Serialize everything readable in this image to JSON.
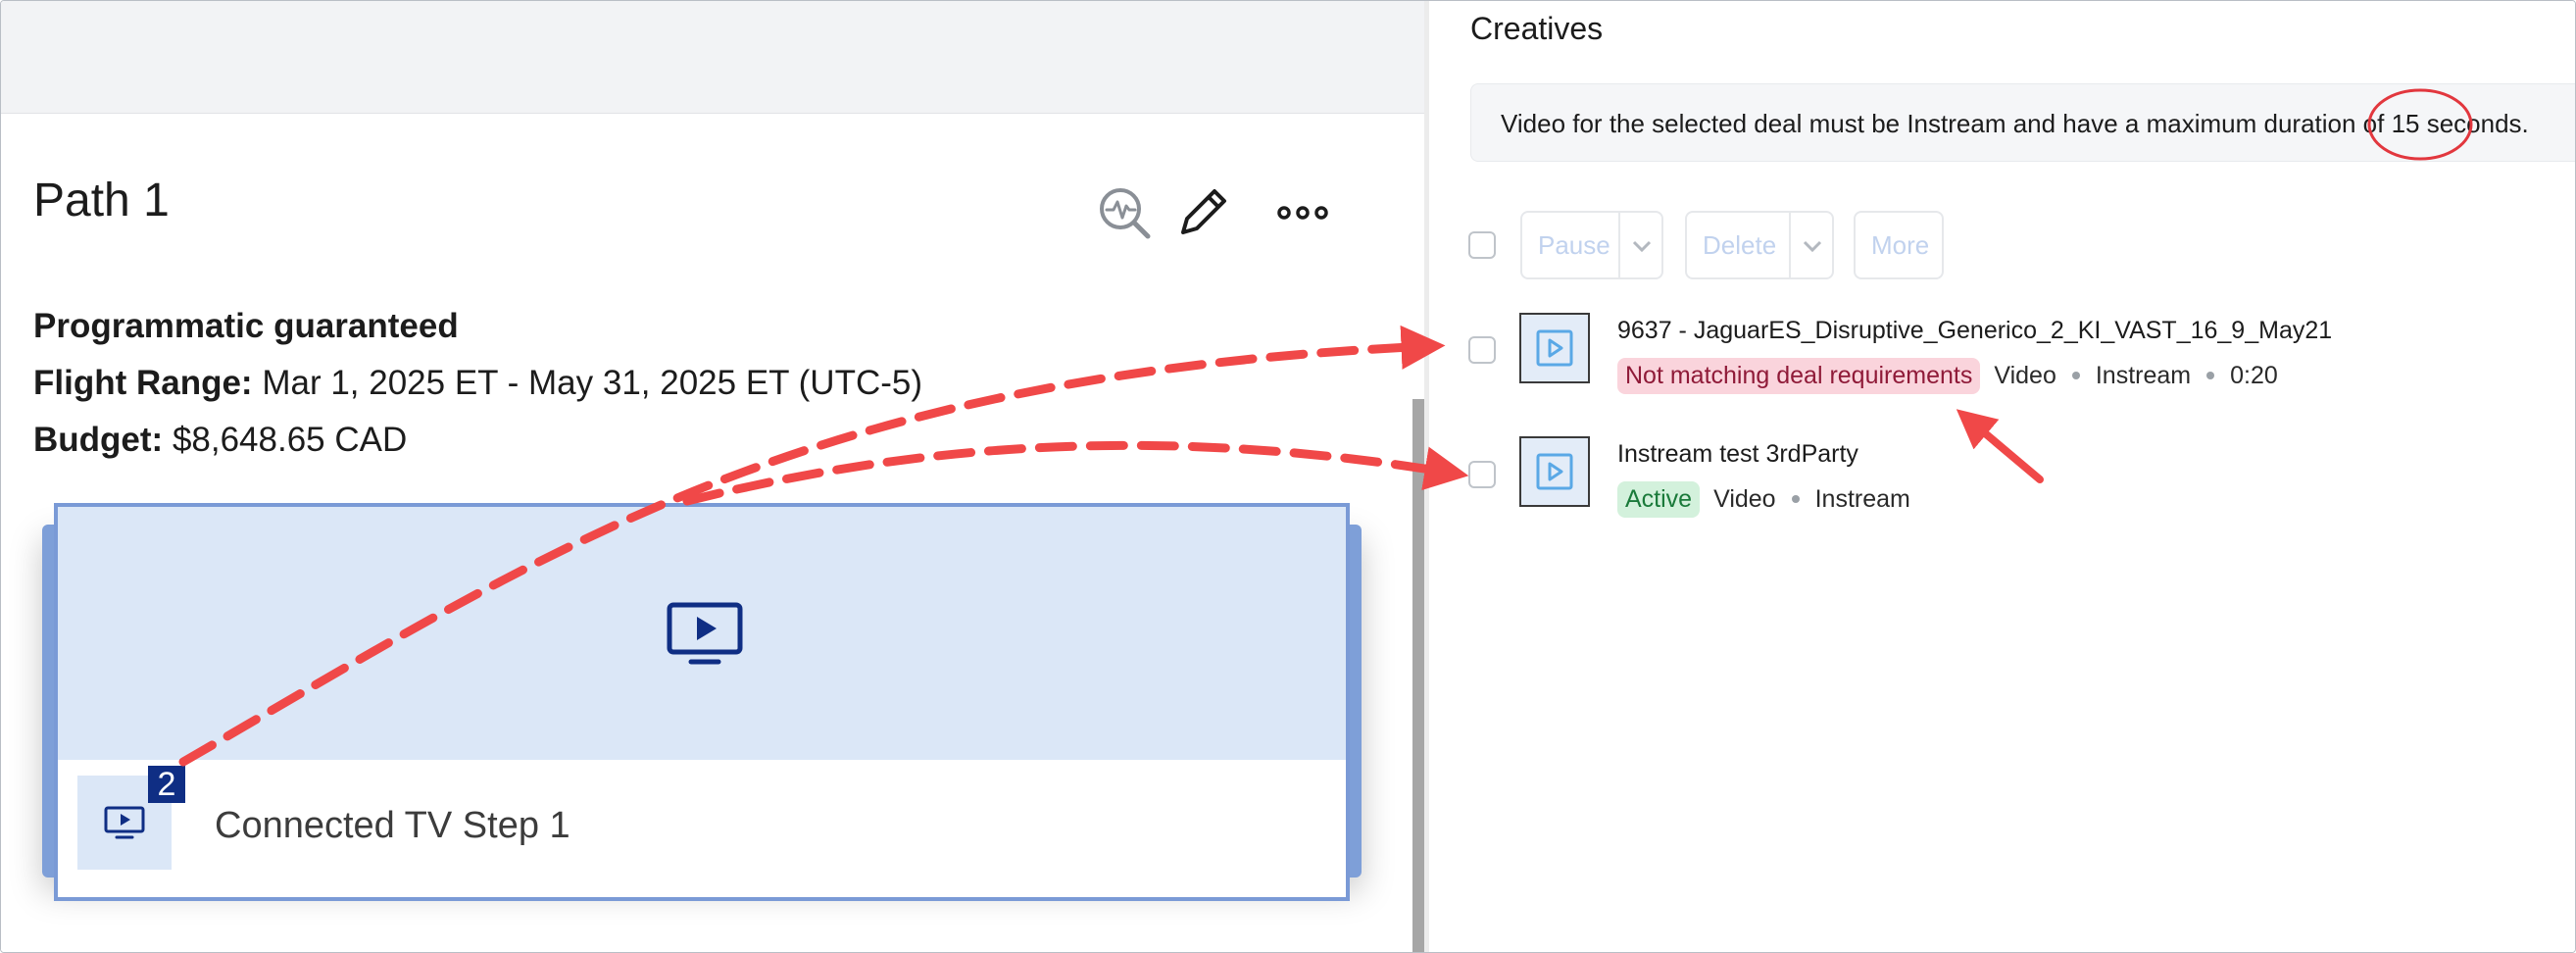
{
  "left": {
    "path_title": "Path 1",
    "deal_type": "Programmatic guaranteed",
    "flight_label": "Flight Range:",
    "flight_value": "Mar 1, 2025 ET - May 31, 2025 ET (UTC-5)",
    "budget_label": "Budget:",
    "budget_value": "$8,648.65 CAD",
    "tools": [
      "monitor-icon",
      "edit-icon",
      "more-icon"
    ],
    "step": {
      "badge_count": "2",
      "label": "Connected TV Step 1",
      "icon": "tv-play-icon"
    }
  },
  "right": {
    "title": "Creatives",
    "notice_text": "Video for the selected deal must be Instream and have a maximum duration of 15 seconds.",
    "toolbar": {
      "pause_label": "Pause",
      "delete_label": "Delete",
      "more_label": "More"
    },
    "creatives": [
      {
        "name": "9637 - JaguarES_Disruptive_Generico_2_KI_VAST_16_9_May21",
        "status": "Not matching deal requirements",
        "status_color": "#fad4dc",
        "format": "Video",
        "placement": "Instream",
        "duration": "0:20"
      },
      {
        "name": "Instream test 3rdParty",
        "status": "Active",
        "status_color": "#d3f1dc",
        "format": "Video",
        "placement": "Instream"
      }
    ]
  },
  "colors": {
    "annotation_red": "#f04848",
    "step_badge": "#0f2e84",
    "card_fill": "#dbe7f7",
    "card_border": "#7a9ad6",
    "disabled_button_text": "#c1d2ee"
  }
}
